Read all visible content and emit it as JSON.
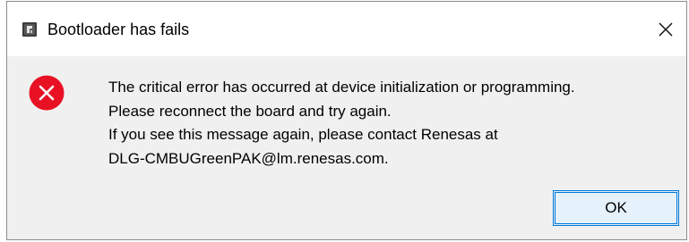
{
  "window": {
    "title": "Bootloader has fails",
    "app_icon": "app-chip-icon",
    "close_icon": "close-icon"
  },
  "message": {
    "icon": "error-icon",
    "lines": [
      "The critical error has occurred at device initialization or programming.",
      "Please reconnect the board and try again.",
      "If you see this message again, please contact Renesas at",
      "DLG-CMBUGreenPAK@lm.renesas.com."
    ]
  },
  "buttons": {
    "ok_label": "OK"
  },
  "colors": {
    "error_red": "#e81123",
    "accent_blue": "#0078d7",
    "dialog_background": "#f0f0f0"
  }
}
